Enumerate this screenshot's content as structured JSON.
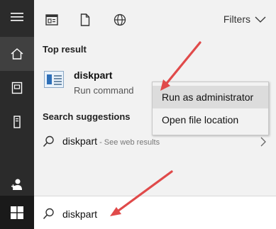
{
  "toolbar": {
    "filters_label": "Filters"
  },
  "top_result": {
    "section_label": "Top result",
    "name": "diskpart",
    "type": "Run command"
  },
  "suggestions": {
    "section_label": "Search suggestions",
    "items": [
      {
        "text": "diskpart",
        "sub": " - See web results"
      }
    ]
  },
  "context_menu": {
    "items": [
      {
        "label": "Run as administrator",
        "highlighted": true
      },
      {
        "label": "Open file location",
        "highlighted": false
      }
    ]
  },
  "search": {
    "query": "diskpart"
  },
  "colors": {
    "rail": "#2b2b2b",
    "start": "#1a1a1a",
    "arrow": "#e04a4a",
    "panel": "#f2f2f2"
  },
  "icons": [
    "hamburger-icon",
    "home-icon",
    "documents-icon",
    "tower-icon",
    "user-icon",
    "windows-logo-icon",
    "apps-icon",
    "document-icon",
    "globe-icon",
    "chevron-down-icon",
    "search-icon",
    "chevron-right-icon"
  ]
}
